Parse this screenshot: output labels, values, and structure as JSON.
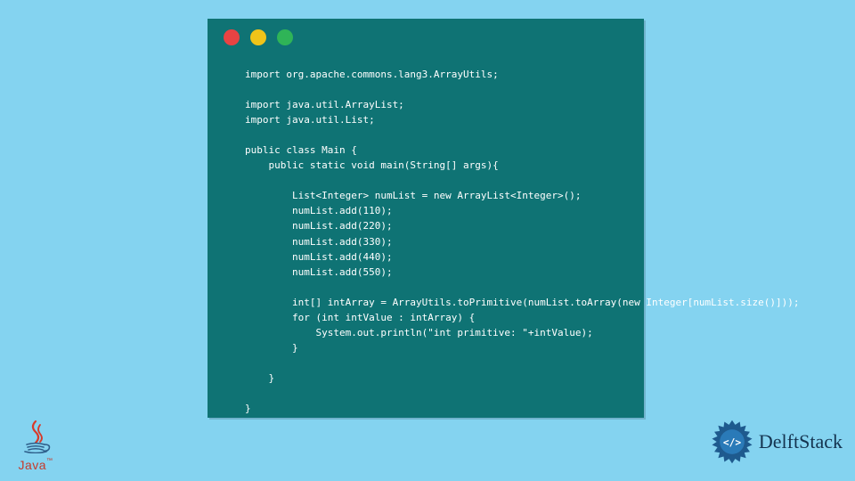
{
  "window": {
    "dots": {
      "red": "#e84343",
      "yellow": "#f0c419",
      "green": "#2fb457"
    }
  },
  "code": {
    "line1": "import org.apache.commons.lang3.ArrayUtils;",
    "line2": "",
    "line3": "import java.util.ArrayList;",
    "line4": "import java.util.List;",
    "line5": "",
    "line6": "public class Main {",
    "line7": "    public static void main(String[] args){",
    "line8": "",
    "line9": "        List<Integer> numList = new ArrayList<Integer>();",
    "line10": "        numList.add(110);",
    "line11": "        numList.add(220);",
    "line12": "        numList.add(330);",
    "line13": "        numList.add(440);",
    "line14": "        numList.add(550);",
    "line15": "",
    "line16": "        int[] intArray = ArrayUtils.toPrimitive(numList.toArray(new Integer[numList.size()]));",
    "line17": "        for (int intValue : intArray) {",
    "line18": "            System.out.println(\"int primitive: \"+intValue);",
    "line19": "        }",
    "line20": "",
    "line21": "    }",
    "line22": "",
    "line23": "}"
  },
  "logos": {
    "java_label": "Java",
    "java_tm": "™",
    "delft_label": "DelftStack"
  }
}
